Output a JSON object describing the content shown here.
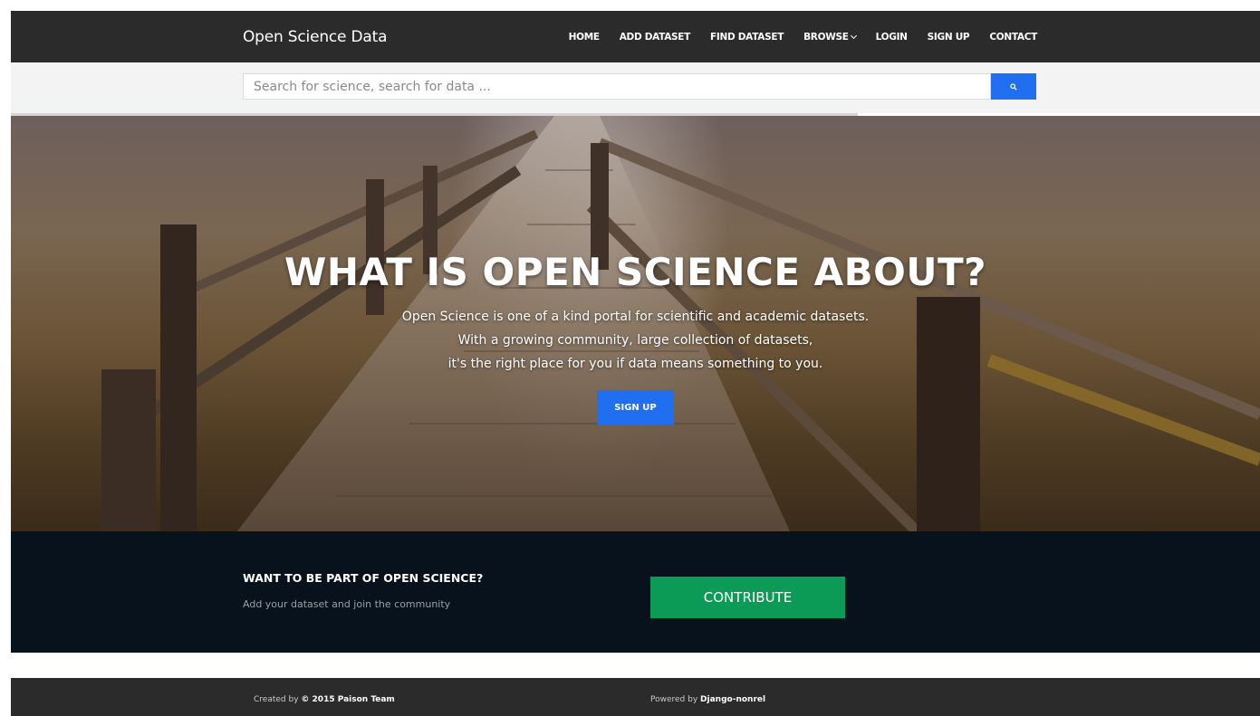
{
  "navbar": {
    "brand": "Open Science Data",
    "items": [
      {
        "label": "HOME"
      },
      {
        "label": "ADD DATASET"
      },
      {
        "label": "FIND DATASET"
      },
      {
        "label": "BROWSE"
      },
      {
        "label": "LOGIN"
      },
      {
        "label": "SIGN UP"
      },
      {
        "label": "CONTACT"
      }
    ]
  },
  "search": {
    "placeholder": "Search for science, search for data ...",
    "value": "",
    "button_icon": "search-icon"
  },
  "hero": {
    "title": "WHAT IS OPEN SCIENCE ABOUT?",
    "lines": [
      "Open Science is one of a kind portal for scientific and academic datasets.",
      "With a growing community, large collection of datasets,",
      "it's the right place for you if data means something to you."
    ],
    "button": "SIGN UP"
  },
  "contribute": {
    "title": "WANT TO BE PART OF OPEN SCIENCE?",
    "subtitle": "Add your dataset and join the community",
    "button": "CONTRIBUTE"
  },
  "footer": {
    "created_prefix": "Created by",
    "created_name": "© 2015 Paison Team",
    "powered_prefix": "Powered by",
    "powered_name": "Django-nonrel"
  },
  "colors": {
    "navbar_bg": "#2b2b2b",
    "accent_blue": "#1f6ff0",
    "contribute_bg": "#07121c",
    "contribute_green": "#0c9a57"
  }
}
